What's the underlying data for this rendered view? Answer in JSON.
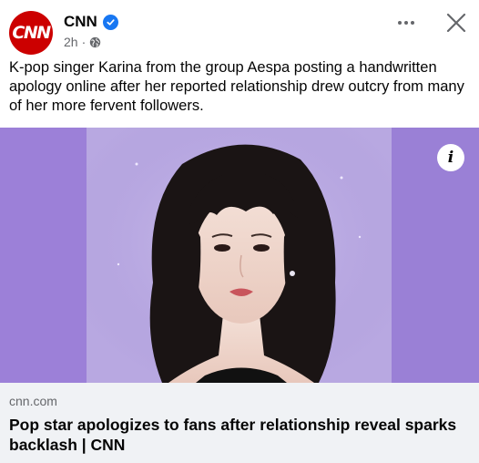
{
  "post": {
    "avatar_text": "CNN",
    "page_name": "CNN",
    "verified": true,
    "timestamp": "2h",
    "separator": "·",
    "audience_icon": "globe-icon",
    "caption": "K-pop singer Karina from the group Aespa posting a handwritten apology online after her reported relationship drew outcry from many of her more fervent followers."
  },
  "media": {
    "info_label": "i"
  },
  "link_preview": {
    "domain": "cnn.com",
    "headline": "Pop star apologizes to fans after relationship reveal sparks backlash | CNN"
  },
  "colors": {
    "brand": "#cc0000",
    "verified": "#1877f2",
    "secondary_text": "#65676b",
    "link_card_bg": "#f0f2f5"
  }
}
